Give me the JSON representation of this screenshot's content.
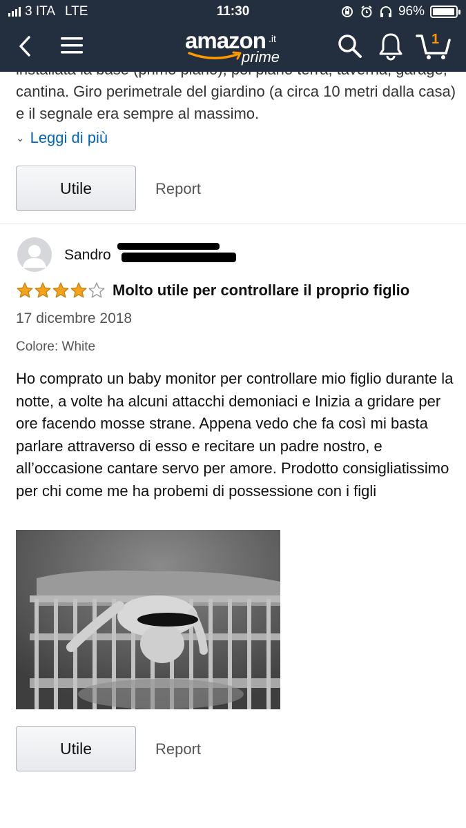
{
  "status_bar": {
    "carrier": "3 ITA",
    "network": "LTE",
    "time": "11:30",
    "battery": "96%",
    "battery_level": 0.96
  },
  "header": {
    "brand": "amazon",
    "domain": ".it",
    "tier": "prime",
    "cart_count": "1"
  },
  "previous_review": {
    "text_partial": "installata la base (primo piano), poi piano terra, taverna, garage, cantina. Giro perimetrale del giardino (a circa 10 metri dalla casa) e il segnale era sempre al massimo.",
    "read_more": "Leggi di più",
    "helpful_button": "Utile",
    "report_link": "Report"
  },
  "review": {
    "reviewer_name": "Sandro",
    "rating": 4,
    "rating_max": 5,
    "title": "Molto utile per controllare il proprio figlio",
    "date": "17 dicembre 2018",
    "variant": "Colore: White",
    "body": "Ho comprato un baby monitor per controllare mio figlio durante la notte, a volte ha alcuni attacchi demoniaci e Inizia a gridare per ore facendo mosse strane. Appena vedo che fa così mi basta parlare attraverso di esso e recitare un padre nostro, e all’occasione cantare servo per amore. Prodotto consigliatissimo per chi come me ha probemi di possessione con i figli",
    "helpful_button": "Utile",
    "report_link": "Report"
  },
  "colors": {
    "header_bg": "#232f3e",
    "star": "#f4a41c",
    "link": "#0066c0",
    "prime_arrow": "#f90"
  }
}
